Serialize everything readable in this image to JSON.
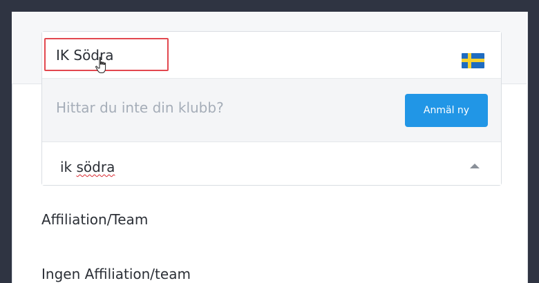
{
  "dropdown": {
    "selected_option": "IK Södra",
    "flag_icon": "sweden-flag-icon",
    "not_found_text": "Hittar du inte din klubb?",
    "register_button": "Anmäl ny",
    "search_value": "ik södra"
  },
  "sections": {
    "affiliation_label": "Affiliation/Team",
    "no_affiliation_label": "Ingen Affiliation/team"
  },
  "colors": {
    "accent_button": "#2196e6",
    "highlight_border": "#e2474e",
    "page_background": "#2f3442"
  }
}
